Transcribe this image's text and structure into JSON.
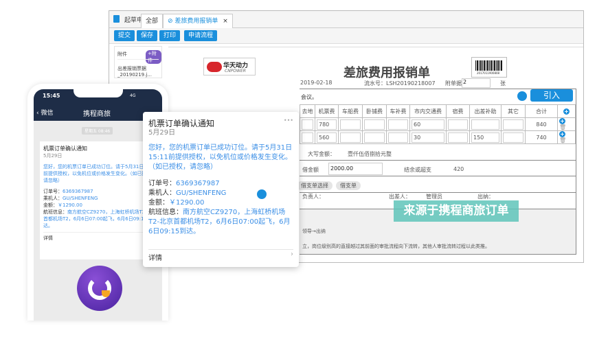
{
  "window": {
    "tabs": [
      {
        "label": "起草申请"
      },
      {
        "label": "全部"
      },
      {
        "label": "差旅费用报销单",
        "close": "×"
      }
    ],
    "toolbar": {
      "submit": "提交",
      "save": "保存",
      "print": "打印",
      "flow": "申请流程"
    },
    "attachments": {
      "title": "附件",
      "add": "+附件",
      "file": "出差报销票据_20190219.j..."
    },
    "form": {
      "logo_cn": "华天动力",
      "logo_en": "CNPOWER",
      "title": "差旅费用报销单",
      "date": "2019-02-18",
      "serial": "流水号：LSH20190218007",
      "attach_label": "附单据",
      "attach_count": "2",
      "attach_unit": "张",
      "reason": "会议。",
      "import_button": "引入",
      "columns": [
        "去地",
        "机票费",
        "车船费",
        "卧铺费",
        "车补费",
        "市内交通费",
        "宿费",
        "出差补助",
        "其它",
        "合计"
      ],
      "rows": [
        {
          "airfare": "780",
          "local": "60",
          "allowance": "",
          "total": "840"
        },
        {
          "airfare": "560",
          "local": "30",
          "allowance": "150",
          "total": "740"
        }
      ],
      "amount_words_label": "大写金额：",
      "amount_words": "壹仟伍佰捌拾元整",
      "loan_label": "借金额",
      "loan_value": "2000.00",
      "balance_label": "结余或超支",
      "balance_value": "420",
      "loan_select": "借支单选择",
      "loan_doc": "借支单",
      "manager_label": "负责人：",
      "traveler_label": "出差人：",
      "traveler_value": "管理员",
      "cashier_label": "出纳：",
      "flow_text": "领导→出纳",
      "note": "立，岗位级别高的直接越过其前面的审批流程向下流转，其他人审批流转过程以此类推。",
      "barcode_number": "2017011900808"
    }
  },
  "overlay": "来源于携程商旅订单",
  "phone": {
    "time": "15:45",
    "signal": "4G",
    "back": "微信",
    "title": "携程商旅",
    "timestamp": "星期五 08:46",
    "detail": "详情"
  },
  "message": {
    "title": "机票订单确认通知",
    "date": "5月29日",
    "body": "您好，您的机票订单已成功订位。请于5月31日15:11前提供授权，以免机位或价格发生变化。（如已授权，请忽略）",
    "order_label": "订单号：",
    "order": "6369367987",
    "passenger_label": "乘机人：",
    "passenger": "GU/SHENFENG",
    "amount_label": "金额：",
    "amount": "￥1290.00",
    "flight_label": "航班信息：",
    "flight": "南方航空CZ9270，上海虹桥机场T2-北京首都机场T2，6月6日07:00起飞，6月6日09:15到达。",
    "detail": "详情",
    "more": "•••"
  },
  "colors": {
    "accent": "#1a8fdc",
    "phone_header": "#1e2d47",
    "overlay": "#5fc4ba",
    "ctrip_purple": "#5a2bb0"
  }
}
